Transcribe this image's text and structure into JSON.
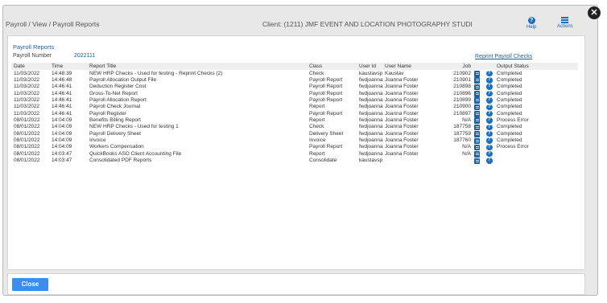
{
  "header": {
    "breadcrumb": "Payroll / View / Payroll Reports",
    "client": "Client: (1211) JMF EVENT AND LOCATION PHOTOGRAPHY STUDI",
    "help_label": "Help",
    "actions_label": "Actions",
    "close_glyph": "✕",
    "help_glyph": "?"
  },
  "panel": {
    "title": "Payroll Reports",
    "payroll_number_label": "Payroll Number",
    "payroll_number_value": "2022111",
    "reprint_link": "Reprint Payroll Checks"
  },
  "table": {
    "columns": {
      "date": "Date",
      "time": "Time",
      "title": "Report Title",
      "class": "Class",
      "user_id": "User Id",
      "user_name": "User Name",
      "job": "Job",
      "status": "Output Status"
    },
    "rows": [
      {
        "date": "11/03/2022",
        "time": "14:48:39",
        "title": "NEW HRP Checks - Used for testing - Reprint Checks (2)",
        "class": "Check",
        "user_id": "kaustavsp",
        "user_name": "Kaustav",
        "job": "210902",
        "status": "Completed",
        "help": "?"
      },
      {
        "date": "11/03/2022",
        "time": "14:46:48",
        "title": "Payroll Allocation Output File",
        "class": "Payroll Report",
        "user_id": "fwdjoanna",
        "user_name": "Joanna Foster",
        "job": "210901",
        "status": "Completed",
        "help": "?"
      },
      {
        "date": "11/03/2022",
        "time": "14:46:41",
        "title": "Deduction Register Cost",
        "class": "Payroll Report",
        "user_id": "fwdjoanna",
        "user_name": "Joanna Foster",
        "job": "210898",
        "status": "Completed",
        "help": "?"
      },
      {
        "date": "11/03/2022",
        "time": "14:46:41",
        "title": "Gross-To-Net Report",
        "class": "Payroll Report",
        "user_id": "fwdjoanna",
        "user_name": "Joanna Foster",
        "job": "210896",
        "status": "Completed",
        "help": "?"
      },
      {
        "date": "11/03/2022",
        "time": "14:46:41",
        "title": "Payroll Allocation Report",
        "class": "Payroll Report",
        "user_id": "fwdjoanna",
        "user_name": "Joanna Foster",
        "job": "210899",
        "status": "Completed",
        "help": "?"
      },
      {
        "date": "11/03/2022",
        "time": "14:46:41",
        "title": "Payroll Check Journal",
        "class": "Report",
        "user_id": "fwdjoanna",
        "user_name": "Joanna Foster",
        "job": "210900",
        "status": "Completed",
        "help": "?"
      },
      {
        "date": "11/03/2022",
        "time": "14:46:41",
        "title": "Payroll Register",
        "class": "Payroll Report",
        "user_id": "fwdjoanna",
        "user_name": "Joanna Foster",
        "job": "210897",
        "status": "Completed",
        "help": "?"
      },
      {
        "date": "08/01/2022",
        "time": "14:04:09",
        "title": "Benefits Billing Report",
        "class": "Report",
        "user_id": "fwdjoanna",
        "user_name": "Joanna Foster",
        "job": "N/A",
        "status": "Process Error",
        "help": "?"
      },
      {
        "date": "08/01/2022",
        "time": "14:04:09",
        "title": "NEW HRP Checks - Used for testing 1",
        "class": "Check",
        "user_id": "fwdjoanna",
        "user_name": "Joanna Foster",
        "job": "187758",
        "status": "Completed",
        "help": "?"
      },
      {
        "date": "08/01/2022",
        "time": "14:04:09",
        "title": "Payroll Delivery Sheet",
        "class": "Delivery Sheet",
        "user_id": "fwdjoanna",
        "user_name": "Joanna Foster",
        "job": "187759",
        "status": "Completed",
        "help": "?"
      },
      {
        "date": "08/01/2022",
        "time": "14:04:09",
        "title": "Invoice",
        "class": "Invoice",
        "user_id": "fwdjoanna",
        "user_name": "Joanna Foster",
        "job": "187760",
        "status": "Completed",
        "help": "?"
      },
      {
        "date": "08/01/2022",
        "time": "14:04:09",
        "title": "Workers Compensation",
        "class": "Payroll Report",
        "user_id": "fwdjoanna",
        "user_name": "Joanna Foster",
        "job": "N/A",
        "status": "Process Error",
        "help": "?"
      },
      {
        "date": "08/01/2022",
        "time": "14:03:47",
        "title": "QuickBooks ASO Client Accounting File",
        "class": "Report",
        "user_id": "fwdjoanna",
        "user_name": "Joanna Foster",
        "job": "N/A",
        "status": "",
        "help": "?"
      },
      {
        "date": "08/01/2022",
        "time": "14:03:47",
        "title": "Consolidated PDF Reports",
        "class": "Consolidate",
        "user_id": "kaustavsp",
        "user_name": "",
        "job": "",
        "status": "",
        "help": "?"
      }
    ]
  },
  "footer": {
    "close_label": "Close"
  },
  "colors": {
    "accent": "#1f6fc0",
    "button": "#3b8ef0"
  }
}
